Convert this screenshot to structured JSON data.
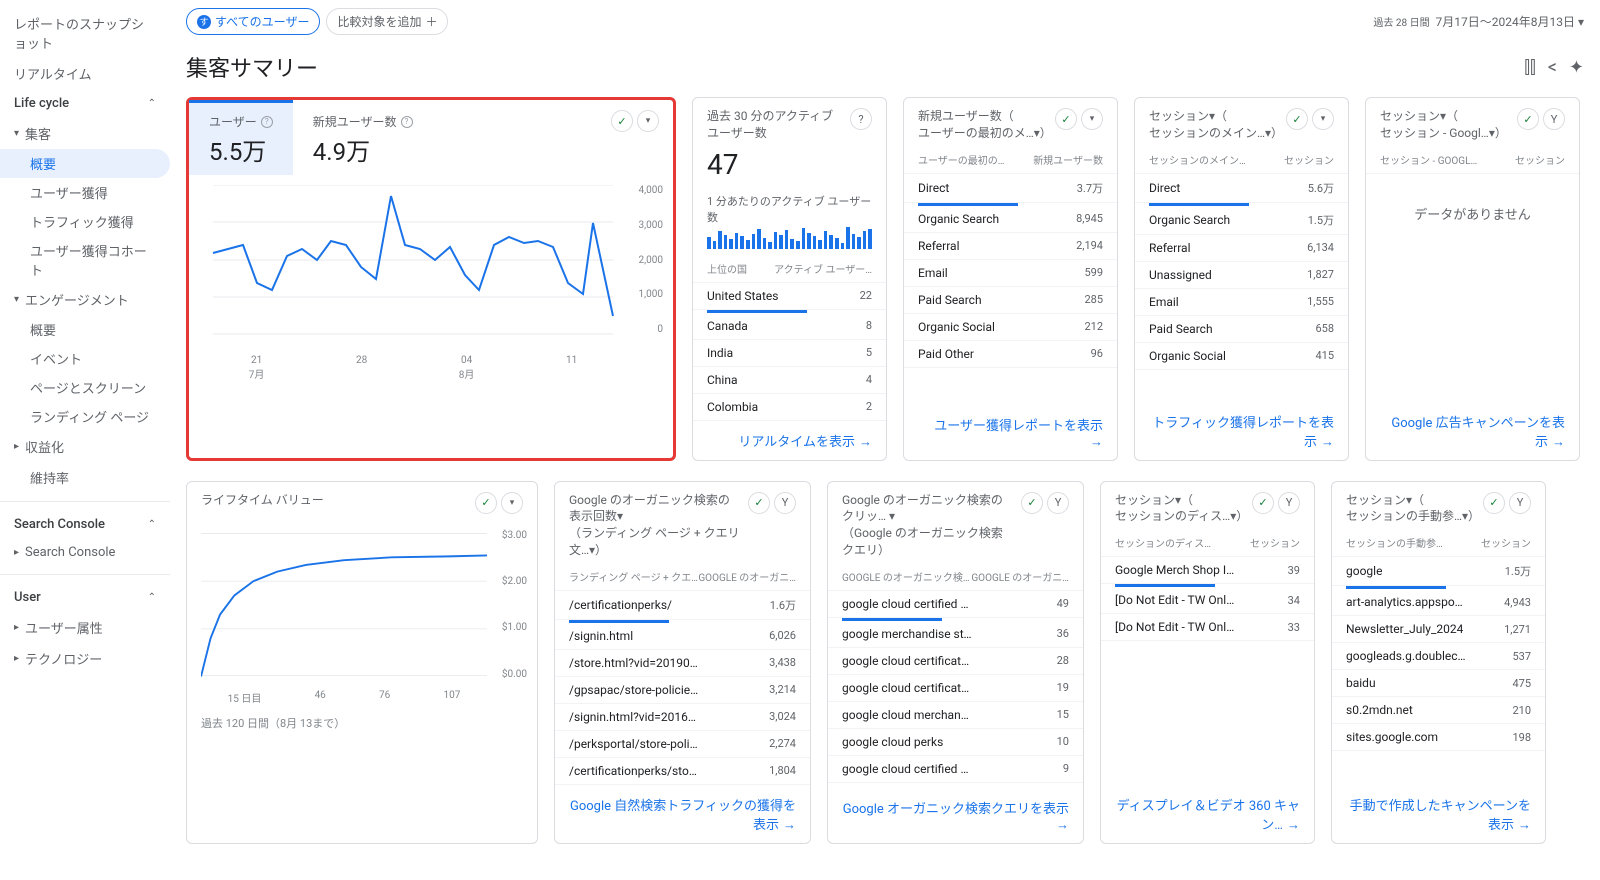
{
  "sidebar": {
    "snapshot": "レポートのスナップショット",
    "realtime": "リアルタイム",
    "lifecycle": "Life cycle",
    "acquisition": "集客",
    "acq_overview": "概要",
    "acq_user": "ユーザー獲得",
    "acq_traffic": "トラフィック獲得",
    "acq_cohort": "ユーザー獲得コホート",
    "engagement": "エンゲージメント",
    "eng_overview": "概要",
    "eng_events": "イベント",
    "eng_pages": "ページとスクリーン",
    "eng_landing": "ランディング ページ",
    "monetization": "収益化",
    "retention": "維持率",
    "search_console": "Search Console",
    "search_console_sub": "Search Console",
    "user": "User",
    "user_attributes": "ユーザー属性",
    "technology": "テクノロジー"
  },
  "top": {
    "pill_all_users": "すべてのユーザー",
    "pill_all_users_badge": "す",
    "pill_add_compare": "比較対象を追加",
    "date_label": "過去 28 日間",
    "date_range": "7月17日～2024年8月13日"
  },
  "title": "集客サマリー",
  "big_chart": {
    "metric1_label": "ユーザー",
    "metric1_value": "5.5万",
    "metric2_label": "新規ユーザー数",
    "metric2_value": "4.9万",
    "y_ticks": [
      "4,000",
      "3,000",
      "2,000",
      "1,000",
      "0"
    ],
    "x_ticks": [
      {
        "top": "21",
        "bottom": "7月"
      },
      {
        "top": "28",
        "bottom": ""
      },
      {
        "top": "04",
        "bottom": "8月"
      },
      {
        "top": "11",
        "bottom": ""
      }
    ]
  },
  "realtime": {
    "title": "過去 30 分のアクティブ ユーザー数",
    "value": "47",
    "per_min": "1 分あたりのアクティブ ユーザー数",
    "col1": "上位の国",
    "col2": "アクティブ ユーザー…",
    "rows": [
      {
        "label": "United States",
        "value": "22"
      },
      {
        "label": "Canada",
        "value": "8"
      },
      {
        "label": "India",
        "value": "5"
      },
      {
        "label": "China",
        "value": "4"
      },
      {
        "label": "Colombia",
        "value": "2"
      }
    ],
    "footer": "リアルタイムを表示"
  },
  "new_users": {
    "title1": "新規ユーザー数（",
    "title2": "ユーザーの最初のメ…▾）",
    "col1": "ユーザーの最初の…",
    "col2": "新規ユーザー数",
    "rows": [
      {
        "label": "Direct",
        "value": "3.7万"
      },
      {
        "label": "Organic Search",
        "value": "8,945"
      },
      {
        "label": "Referral",
        "value": "2,194"
      },
      {
        "label": "Email",
        "value": "599"
      },
      {
        "label": "Paid Search",
        "value": "285"
      },
      {
        "label": "Organic Social",
        "value": "212"
      },
      {
        "label": "Paid Other",
        "value": "96"
      }
    ],
    "footer": "ユーザー獲得レポートを表示"
  },
  "sessions_medium": {
    "title1": "セッション▾（",
    "title2": "セッションのメイン…▾）",
    "col1": "セッションのメイン…",
    "col2": "セッション",
    "rows": [
      {
        "label": "Direct",
        "value": "5.6万"
      },
      {
        "label": "Organic Search",
        "value": "1.5万"
      },
      {
        "label": "Referral",
        "value": "6,134"
      },
      {
        "label": "Unassigned",
        "value": "1,827"
      },
      {
        "label": "Email",
        "value": "1,555"
      },
      {
        "label": "Paid Search",
        "value": "658"
      },
      {
        "label": "Organic Social",
        "value": "415"
      }
    ],
    "footer": "トラフィック獲得レポートを表示"
  },
  "sessions_google": {
    "title1": "セッション▾（",
    "title2": "セッション - Googl…▾）",
    "col1": "セッション - GOOGL…",
    "col2": "セッション",
    "no_data": "データがありません",
    "footer": "Google 広告キャンペーンを表示"
  },
  "ltv": {
    "title": "ライフタイム バリュー",
    "y_ticks": [
      "$3.00",
      "$2.00",
      "$1.00",
      "$0.00"
    ],
    "x_ticks": [
      "15\n日目",
      "46",
      "76",
      "107"
    ],
    "note": "過去 120 日間（8月 13まで）"
  },
  "organic_impressions": {
    "title1": "Google のオーガニック検索の表示回数▾",
    "title2": "（ランディング ページ + クエリ文…▾）",
    "col1": "ランディング ページ + クエ…",
    "col2": "GOOGLE のオーガニ…",
    "rows": [
      {
        "label": "/certificationperks/",
        "value": "1.6万"
      },
      {
        "label": "/signin.html",
        "value": "6,026"
      },
      {
        "label": "/store.html?vid=201905223…",
        "value": "3,438"
      },
      {
        "label": "/gpsapac/store-policies/fre…",
        "value": "3,214"
      },
      {
        "label": "/signin.html?vid=201605125…",
        "value": "3,024"
      },
      {
        "label": "/perksportal/store-policies/f…",
        "value": "2,274"
      },
      {
        "label": "/certificationperks/store-pol…",
        "value": "1,804"
      }
    ],
    "footer": "Google 自然検索トラフィックの獲得を表示"
  },
  "organic_clicks": {
    "title1": "Google のオーガニック検索のクリッ… ▾",
    "title2": "（Google のオーガニック検索クエリ）",
    "col1": "GOOGLE のオーガニック検…",
    "col2": "GOOGLE のオーガニ…",
    "rows": [
      {
        "label": "google cloud certified merch…",
        "value": "49"
      },
      {
        "label": "google merchandise store",
        "value": "36"
      },
      {
        "label": "google cloud certification pe…",
        "value": "28"
      },
      {
        "label": "google cloud certification m…",
        "value": "19"
      },
      {
        "label": "google cloud merchandise",
        "value": "15"
      },
      {
        "label": "google cloud perks",
        "value": "10"
      },
      {
        "label": "google cloud certified perks …",
        "value": "9"
      }
    ],
    "footer": "Google オーガニック検索クエリを表示"
  },
  "sessions_display": {
    "title1": "セッション▾（",
    "title2": "セッションのディス…▾）",
    "col1": "セッションのディス…",
    "col2": "セッション",
    "rows": [
      {
        "label": "Google Merch Shop I…",
        "value": "39"
      },
      {
        "label": "[Do Not Edit - TW Onl…",
        "value": "34"
      },
      {
        "label": "[Do Not Edit - TW Onl…",
        "value": "33"
      }
    ],
    "footer": "ディスプレイ＆ビデオ 360 キャン…"
  },
  "sessions_manual": {
    "title1": "セッション▾（",
    "title2": "セッションの手動参…▾）",
    "col1": "セッションの手動参…",
    "col2": "セッション",
    "rows": [
      {
        "label": "google",
        "value": "1.5万"
      },
      {
        "label": "art-analytics.appspo…",
        "value": "4,943"
      },
      {
        "label": "Newsletter_July_2024",
        "value": "1,271"
      },
      {
        "label": "googleads.g.doublec…",
        "value": "537"
      },
      {
        "label": "baidu",
        "value": "475"
      },
      {
        "label": "s0.2mdn.net",
        "value": "210"
      },
      {
        "label": "sites.google.com",
        "value": "198"
      }
    ],
    "footer": "手動で作成したキャンペーンを表示"
  },
  "chart_data": [
    {
      "type": "line",
      "title": "ユーザー",
      "ylim": [
        0,
        4000
      ],
      "x": [
        "7/17",
        "7/18",
        "7/19",
        "7/20",
        "7/21",
        "7/22",
        "7/23",
        "7/24",
        "7/25",
        "7/26",
        "7/27",
        "7/28",
        "7/29",
        "7/30",
        "7/31",
        "8/01",
        "8/02",
        "8/03",
        "8/04",
        "8/05",
        "8/06",
        "8/07",
        "8/08",
        "8/09",
        "8/10",
        "8/11",
        "8/12",
        "8/13"
      ],
      "values": [
        2200,
        2300,
        2400,
        1400,
        1200,
        2100,
        2300,
        2000,
        2500,
        2400,
        1800,
        1500,
        3700,
        2400,
        2300,
        2000,
        2350,
        1600,
        1200,
        2400,
        2600,
        2450,
        2500,
        2350,
        1400,
        1100,
        3000,
        500
      ]
    },
    {
      "type": "line",
      "title": "ライフタイム バリュー",
      "xlabel": "日目",
      "ylim": [
        0,
        3
      ],
      "x": [
        0,
        15,
        30,
        46,
        60,
        76,
        90,
        107,
        120
      ],
      "values": [
        0.0,
        1.5,
        2.0,
        2.2,
        2.35,
        2.45,
        2.5,
        2.52,
        2.53
      ]
    }
  ]
}
